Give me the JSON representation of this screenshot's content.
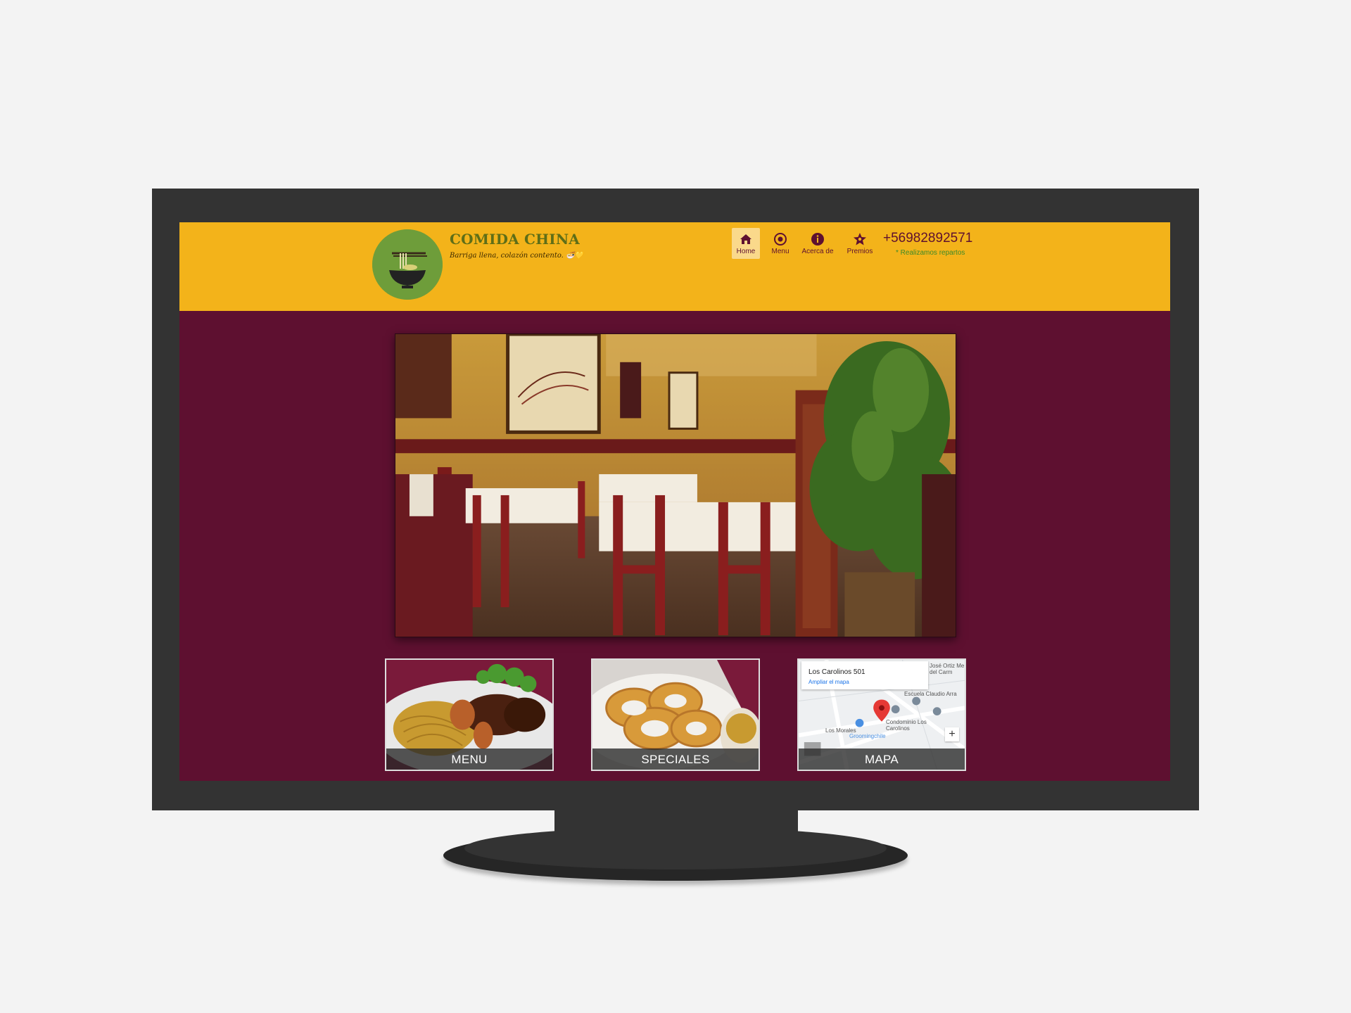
{
  "brand": {
    "title": "COMIDA CHINA",
    "tagline": "Barriga llena, colazón contento. 🍜💛"
  },
  "nav": {
    "items": [
      {
        "label": "Home",
        "icon": "home-icon",
        "active": true
      },
      {
        "label": "Menu",
        "icon": "menu-plate-icon",
        "active": false
      },
      {
        "label": "Acerca de",
        "icon": "info-icon",
        "active": false
      },
      {
        "label": "Premios",
        "icon": "star-icon",
        "active": false
      }
    ],
    "phone": "+56982892571",
    "delivery": "* Realizamos repartos"
  },
  "cards": [
    {
      "caption": "MENU"
    },
    {
      "caption": "SPECIALES"
    },
    {
      "caption": "MAPA"
    }
  ],
  "map": {
    "title": "Los Carolinos 501",
    "link": "Ampliar el mapa",
    "labels": {
      "school": "Escuela Claudio Arra",
      "condo": "Condominio Los Carolinos",
      "groom": "Groomingchile",
      "street": "Los Morales",
      "corner": "José Ortiz Me del Carm",
      "zoom": "+"
    }
  },
  "colors": {
    "header": "#f3b31a",
    "background": "#5e1030",
    "brand_green": "#5e6e17",
    "monitor": "#333333"
  }
}
